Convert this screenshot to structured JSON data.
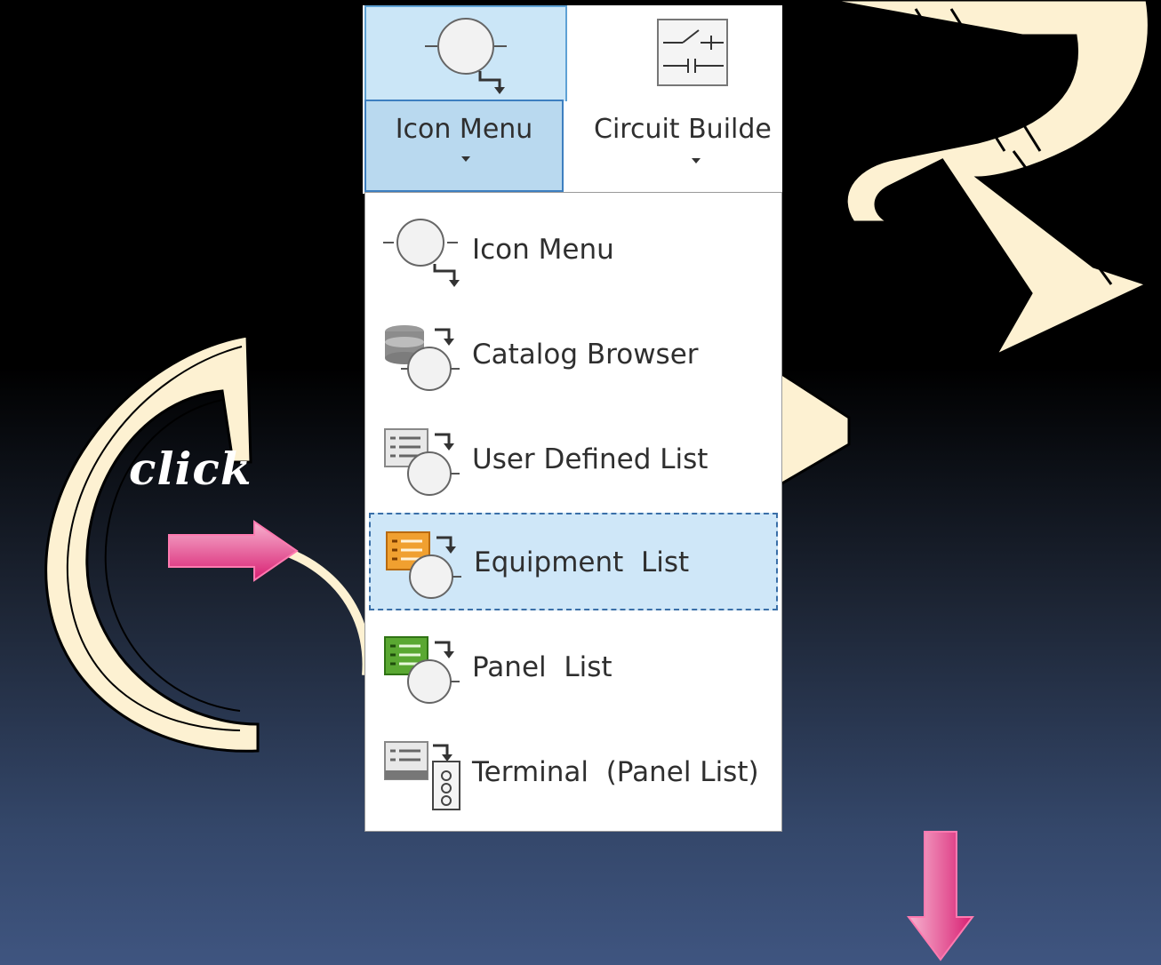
{
  "overlay": {
    "click_text": "click",
    "decorative_letters": [
      "C",
      "P"
    ],
    "arrow_color": "#e23c86",
    "letter_color": "#fdf1d2"
  },
  "ribbon": {
    "icon_menu_label": "Icon Menu",
    "circuit_builder_label": "Circuit Builde",
    "highlight_color": "#b9d9ef"
  },
  "dropdown": {
    "items": [
      {
        "label": "Icon Menu",
        "icon": "icon-menu-icon"
      },
      {
        "label": "Catalog Browser",
        "icon": "catalog-browser-icon"
      },
      {
        "label": "User Defined List",
        "icon": "user-defined-list-icon"
      },
      {
        "label": "Equipment  List",
        "icon": "equipment-list-icon",
        "selected": true
      },
      {
        "label": "Panel  List",
        "icon": "panel-list-icon"
      },
      {
        "label": "Terminal  (Panel List)",
        "icon": "terminal-panel-list-icon"
      }
    ],
    "selected_color": "#cfe7f8"
  }
}
